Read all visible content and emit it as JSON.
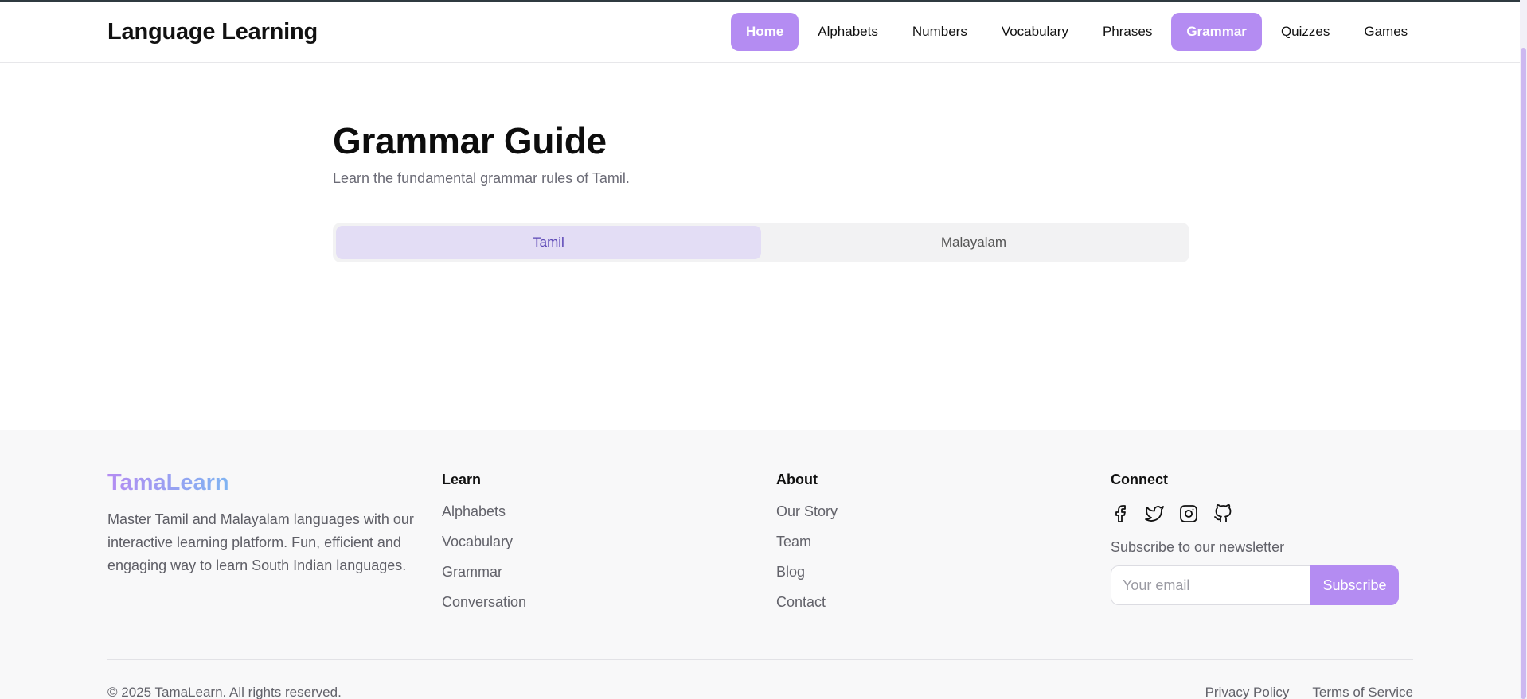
{
  "header": {
    "brand": "Language Learning",
    "nav": [
      {
        "label": "Home",
        "active": true
      },
      {
        "label": "Alphabets",
        "active": false
      },
      {
        "label": "Numbers",
        "active": false
      },
      {
        "label": "Vocabulary",
        "active": false
      },
      {
        "label": "Phrases",
        "active": false
      },
      {
        "label": "Grammar",
        "active": true
      },
      {
        "label": "Quizzes",
        "active": false
      },
      {
        "label": "Games",
        "active": false
      }
    ]
  },
  "main": {
    "title": "Grammar Guide",
    "subtitle": "Learn the fundamental grammar rules of Tamil.",
    "tabs": [
      {
        "label": "Tamil",
        "active": true
      },
      {
        "label": "Malayalam",
        "active": false
      }
    ]
  },
  "footer": {
    "brand": "TamaLearn",
    "description": "Master Tamil and Malayalam languages with our interactive learning platform. Fun, efficient and engaging way to learn South Indian languages.",
    "learn": {
      "heading": "Learn",
      "links": [
        "Alphabets",
        "Vocabulary",
        "Grammar",
        "Conversation"
      ]
    },
    "about": {
      "heading": "About",
      "links": [
        "Our Story",
        "Team",
        "Blog",
        "Contact"
      ]
    },
    "connect": {
      "heading": "Connect",
      "social_icons": [
        "facebook-icon",
        "twitter-icon",
        "instagram-icon",
        "github-icon"
      ],
      "newsletter_label": "Subscribe to our newsletter",
      "email_placeholder": "Your email",
      "subscribe_label": "Subscribe"
    },
    "copyright": "© 2025 TamaLearn. All rights reserved.",
    "legal": [
      "Privacy Policy",
      "Terms of Service"
    ]
  },
  "colors": {
    "accent": "#b48cf2",
    "tab_active_bg": "#e3ddf5",
    "tab_active_text": "#5a45b5",
    "footer_bg": "#f8f8f9"
  }
}
